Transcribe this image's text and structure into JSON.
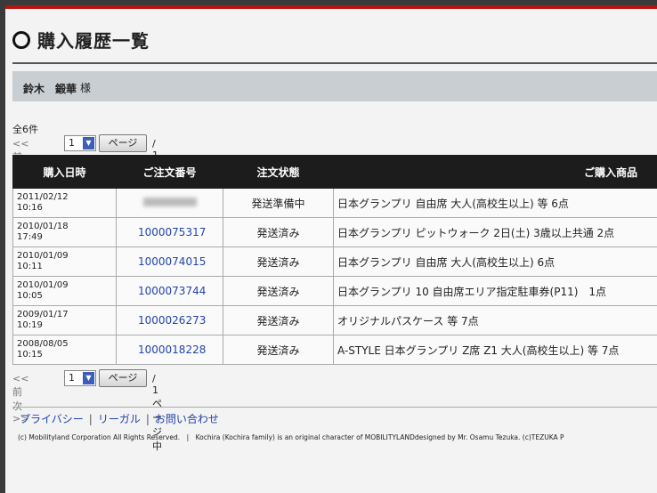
{
  "page": {
    "title": "購入履歴一覧",
    "user_name": "鈴木　鍛華",
    "user_suffix": "様",
    "total_count": "全6件"
  },
  "pager": {
    "prev_next": "<<前 次>>",
    "page_select": "1",
    "page_button": "ページ",
    "page_text": "/ 1ページ中"
  },
  "table": {
    "headers": [
      "購入日時",
      "ご注文番号",
      "注文状態",
      "ご購入商品"
    ],
    "rows": [
      {
        "date": "2011/02/12",
        "time": "10:16",
        "order": "",
        "status": "発送準備中",
        "product": "日本グランプリ 自由席 大人(高校生以上) 等 6点"
      },
      {
        "date": "2010/01/18",
        "time": "17:49",
        "order": "1000075317",
        "status": "発送済み",
        "product": "日本グランプリ ピットウォーク 2日(土) 3歳以上共通 2点"
      },
      {
        "date": "2010/01/09",
        "time": "10:11",
        "order": "1000074015",
        "status": "発送済み",
        "product": "日本グランプリ 自由席 大人(高校生以上) 6点"
      },
      {
        "date": "2010/01/09",
        "time": "10:05",
        "order": "1000073744",
        "status": "発送済み",
        "product": "日本グランプリ 10 自由席エリア指定駐車券(P11)　1点"
      },
      {
        "date": "2009/01/17",
        "time": "10:19",
        "order": "1000026273",
        "status": "発送済み",
        "product": "オリジナルパスケース 等 7点"
      },
      {
        "date": "2008/08/05",
        "time": "10:15",
        "order": "1000018228",
        "status": "発送済み",
        "product": "A-STYLE 日本グランプリ Z席 Z1 大人(高校生以上) 等 7点"
      }
    ]
  },
  "footer": {
    "privacy": "プライバシー",
    "legal": "リーガル",
    "contact": "お問い合わせ",
    "sep": "|",
    "copyright": "(c) Mobilityland Corporation All Rights Reserved.　|　Kochira (Kochira family) is an original character of MOBILITYLANDdesigned by Mr. Osamu Tezuka. (c)TEZUKA P"
  },
  "colors": {
    "accent": "#b8130f",
    "header_bg": "#1c1c1c",
    "link": "#2244aa",
    "user_bar": "#c9ced2"
  }
}
